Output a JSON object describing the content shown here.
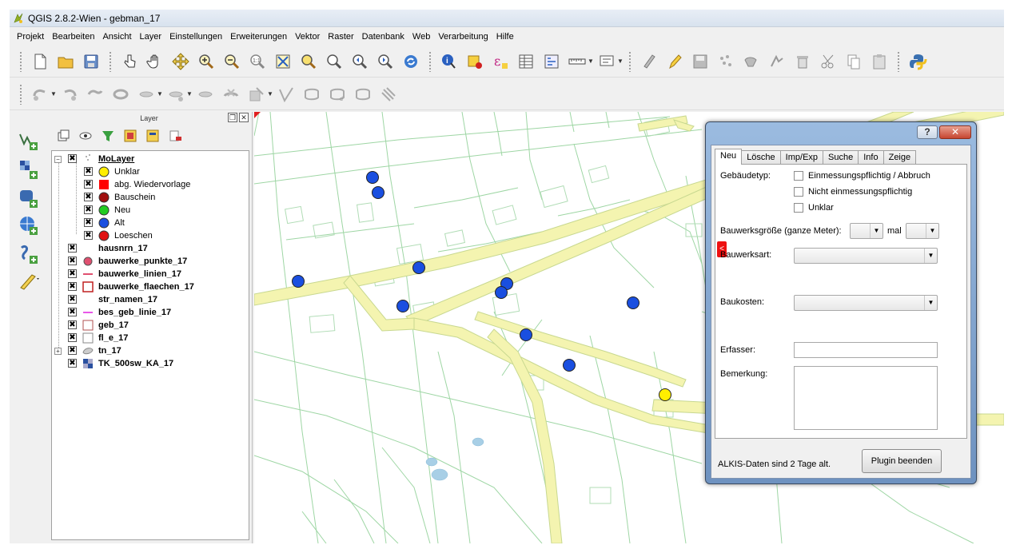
{
  "window": {
    "title": "QGIS 2.8.2-Wien - gebman_17"
  },
  "menu": [
    "Projekt",
    "Bearbeiten",
    "Ansicht",
    "Layer",
    "Einstellungen",
    "Erweiterungen",
    "Vektor",
    "Raster",
    "Datenbank",
    "Web",
    "Verarbeitung",
    "Hilfe"
  ],
  "layer_panel": {
    "title": "Layer",
    "float_label": "❐",
    "close_label": "✕",
    "layers": [
      {
        "label": "MoLayer",
        "style": "group"
      },
      {
        "label": "Unklar",
        "symbol": "yellow-circle"
      },
      {
        "label": "abg. Wiedervorlage",
        "symbol": "red-square"
      },
      {
        "label": "Bauschein",
        "symbol": "darkred-circle"
      },
      {
        "label": "Neu",
        "symbol": "green-circle"
      },
      {
        "label": "Alt",
        "symbol": "blue-circle"
      },
      {
        "label": "Loeschen",
        "symbol": "red-circle"
      },
      {
        "label": "hausnrn_17",
        "symbol": "none"
      },
      {
        "label": "bauwerke_punkte_17",
        "symbol": "pink-circle"
      },
      {
        "label": "bauwerke_linien_17",
        "symbol": "pink-line"
      },
      {
        "label": "bauwerke_flaechen_17",
        "symbol": "red-outline-square"
      },
      {
        "label": "str_namen_17",
        "symbol": "none"
      },
      {
        "label": "bes_geb_linie_17",
        "symbol": "magenta-line"
      },
      {
        "label": "geb_17",
        "symbol": "brown-outline-square"
      },
      {
        "label": "fl_e_17",
        "symbol": "gray-outline-square"
      },
      {
        "label": "tn_17",
        "symbol": "gray-shape"
      },
      {
        "label": "TK_500sw_KA_17",
        "symbol": "raster"
      }
    ]
  },
  "dialog": {
    "help_label": "?",
    "close_label": "✕",
    "tabs": [
      "Neu",
      "Lösche",
      "Imp/Exp",
      "Suche",
      "Info",
      "Zeige"
    ],
    "active_tab": "Neu",
    "side_button": "<",
    "gebaeudetyp_label": "Gebäudetyp:",
    "checkboxes": [
      "Einmessungspflichtig / Abbruch",
      "Nicht einmessungspflichtig",
      "Unklar"
    ],
    "groesse_label": "Bauwerksgröße (ganze Meter):",
    "mal_label": "mal",
    "bauwerksart_label": "Bauwerksart:",
    "baukosten_label": "Baukosten:",
    "erfasser_label": "Erfasser:",
    "bemerkung_label": "Bemerkung:",
    "status_text": "ALKIS-Daten sind 2 Tage alt.",
    "plugin_button": "Plugin beenden",
    "combo_arrow": "▼"
  },
  "colors": {
    "road_fill": "#f4f4b0",
    "road_outline": "#c8d890",
    "parcel_line": "#9ed6a4",
    "point_blue": "#1a4fe0",
    "point_yellow": "#ffee00",
    "water": "#a8cfe6"
  }
}
